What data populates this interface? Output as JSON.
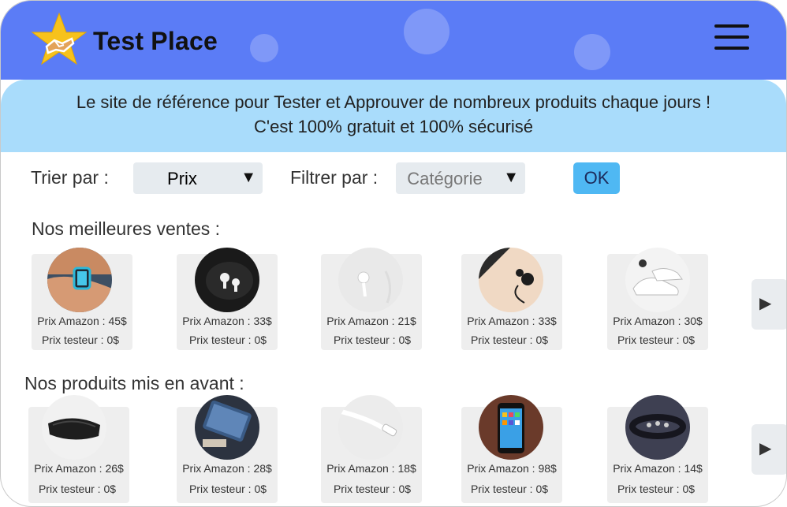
{
  "header": {
    "brand": "Test Place",
    "logo_icon": "star-handshake-icon",
    "menu_icon": "hamburger-menu-icon",
    "color": "#5b7cf6"
  },
  "banner": {
    "line1": "Le site de référence pour Tester et Approuver de nombreux produits chaque jours !",
    "line2": "C'est 100% gratuit et 100% sécurisé",
    "color": "#a9dcfb"
  },
  "filters": {
    "sort_label": "Trier par :",
    "sort_value": "Prix",
    "filter_label": "Filtrer par :",
    "filter_value": "Catégorie",
    "ok_label": "OK",
    "ok_color": "#4fb8f3"
  },
  "best_sellers": {
    "title": "Nos meilleures ventes :",
    "items": [
      {
        "amazon": "Prix Amazon : 45$",
        "tester": "Prix testeur : 0$",
        "image": "smartwatch"
      },
      {
        "amazon": "Prix Amazon : 33$",
        "tester": "Prix testeur : 0$",
        "image": "white-earbuds-dark"
      },
      {
        "amazon": "Prix Amazon : 21$",
        "tester": "Prix testeur : 0$",
        "image": "white-earphones"
      },
      {
        "amazon": "Prix Amazon : 33$",
        "tester": "Prix testeur : 0$",
        "image": "black-earbuds-laptop"
      },
      {
        "amazon": "Prix Amazon : 30$",
        "tester": "Prix testeur : 0$",
        "image": "white-sneakers"
      }
    ]
  },
  "featured": {
    "title": "Nos produits mis en avant :",
    "items": [
      {
        "amazon": "Prix Amazon : 26$",
        "tester": "Prix testeur : 0$",
        "image": "black-mouse"
      },
      {
        "amazon": "Prix Amazon : 28$",
        "tester": "Prix testeur : 0$",
        "image": "power-bank"
      },
      {
        "amazon": "Prix Amazon : 18$",
        "tester": "Prix testeur : 0$",
        "image": "usb-c-cable"
      },
      {
        "amazon": "Prix Amazon : 98$",
        "tester": "Prix testeur : 0$",
        "image": "smartphone"
      },
      {
        "amazon": "Prix Amazon : 14$",
        "tester": "Prix testeur : 0$",
        "image": "bracelet"
      }
    ]
  },
  "nav": {
    "next_icon": "play-right-icon"
  }
}
